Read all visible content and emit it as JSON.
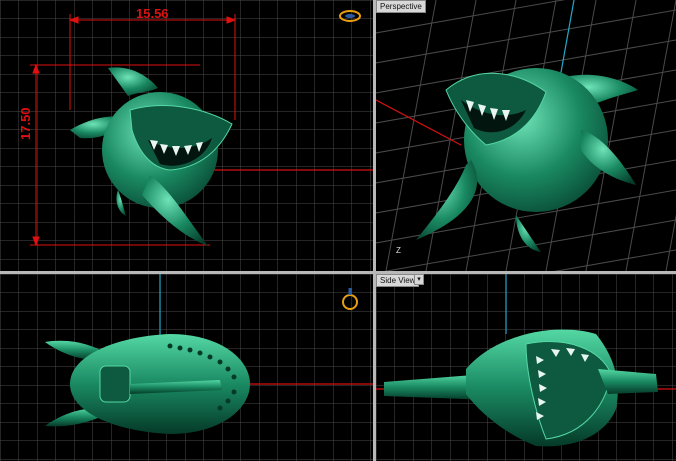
{
  "viewports": {
    "top_left": {
      "name": "front-view",
      "dim_width": "15.56",
      "dim_height": "17.50"
    },
    "top_right": {
      "name": "perspective-view",
      "label": "Perspective",
      "axis_label": "Z"
    },
    "bottom_left": {
      "name": "top-view"
    },
    "bottom_right": {
      "name": "side-view",
      "label": "Side View",
      "dropdown": "▾"
    }
  },
  "colors": {
    "grid": "#4a4a4a",
    "background": "#000000",
    "model": "#1a8a63",
    "model_highlight": "#54d8a4",
    "dimension": "#e01010",
    "axis_x": "#d81010",
    "axis_y": "#23a8c8",
    "ring_icon": "#e8a010"
  },
  "icons": [
    "ring-icon",
    "dimension-arrow-icon",
    "shark-model"
  ]
}
